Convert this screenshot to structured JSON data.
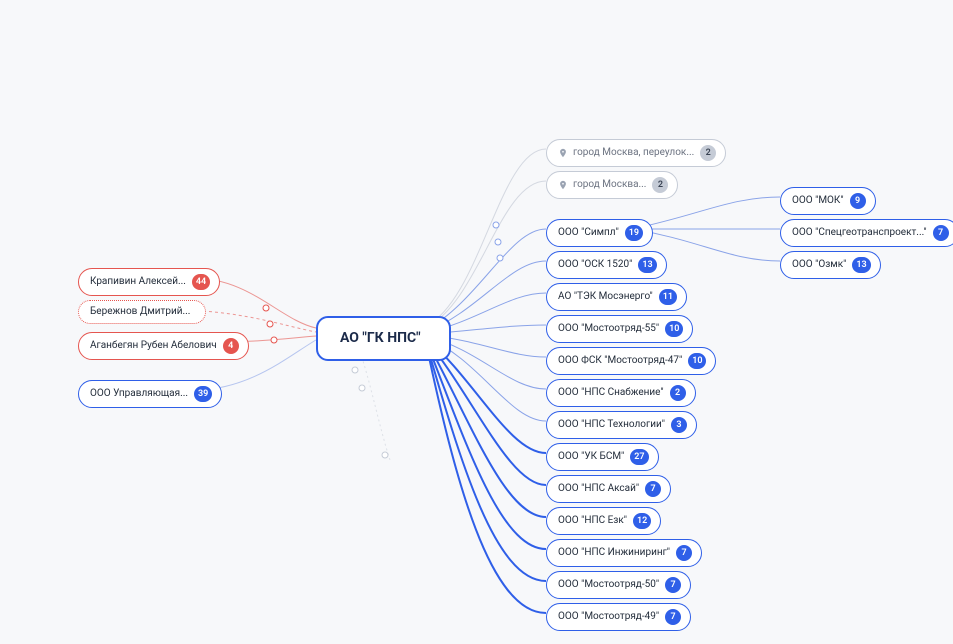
{
  "center": {
    "label": "АО \"ГК НПС\""
  },
  "left": {
    "persons": [
      {
        "label": "Крапивин Алексей...",
        "count": 44,
        "style": "red-border"
      },
      {
        "label": "Бережнов Дмитрий...",
        "count": null,
        "style": "red-dotted"
      },
      {
        "label": "Аганбегян Рубен Абелович",
        "count": 4,
        "style": "red-border"
      }
    ],
    "company": {
      "label": "ООО Управляющая...",
      "count": 39
    }
  },
  "addresses": [
    {
      "label": "город Москва, переулок...",
      "count": 2
    },
    {
      "label": "город Москва...",
      "count": 2
    }
  ],
  "right": [
    {
      "label": "ООО \"Симпл\"",
      "count": 19
    },
    {
      "label": "ООО \"ОСК 1520\"",
      "count": 13
    },
    {
      "label": "АО \"ТЭК Мосэнерго\"",
      "count": 11
    },
    {
      "label": "ООО \"Мостоотряд-55\"",
      "count": 10
    },
    {
      "label": "ООО ФСК \"Мостоотряд-47\"",
      "count": 10
    },
    {
      "label": "ООО \"НПС Снабжение\"",
      "count": 2
    },
    {
      "label": "ООО \"НПС Технологии\"",
      "count": 3
    },
    {
      "label": "ООО \"УК БСМ\"",
      "count": 27
    },
    {
      "label": "ООО \"НПС Аксай\"",
      "count": 7
    },
    {
      "label": "ООО \"НПС Езк\"",
      "count": 12
    },
    {
      "label": "ООО \"НПС Инжиниринг\"",
      "count": 7
    },
    {
      "label": "ООО \"Мостоотряд-50\"",
      "count": 7
    },
    {
      "label": "ООО \"Мостоотряд-49\"",
      "count": 7
    }
  ],
  "far": [
    {
      "label": "ООО \"МОК\"",
      "count": 9
    },
    {
      "label": "ООО \"Спецгеотранспроект...\"",
      "count": 7
    },
    {
      "label": "ООО \"Озмк\"",
      "count": 13
    }
  ]
}
